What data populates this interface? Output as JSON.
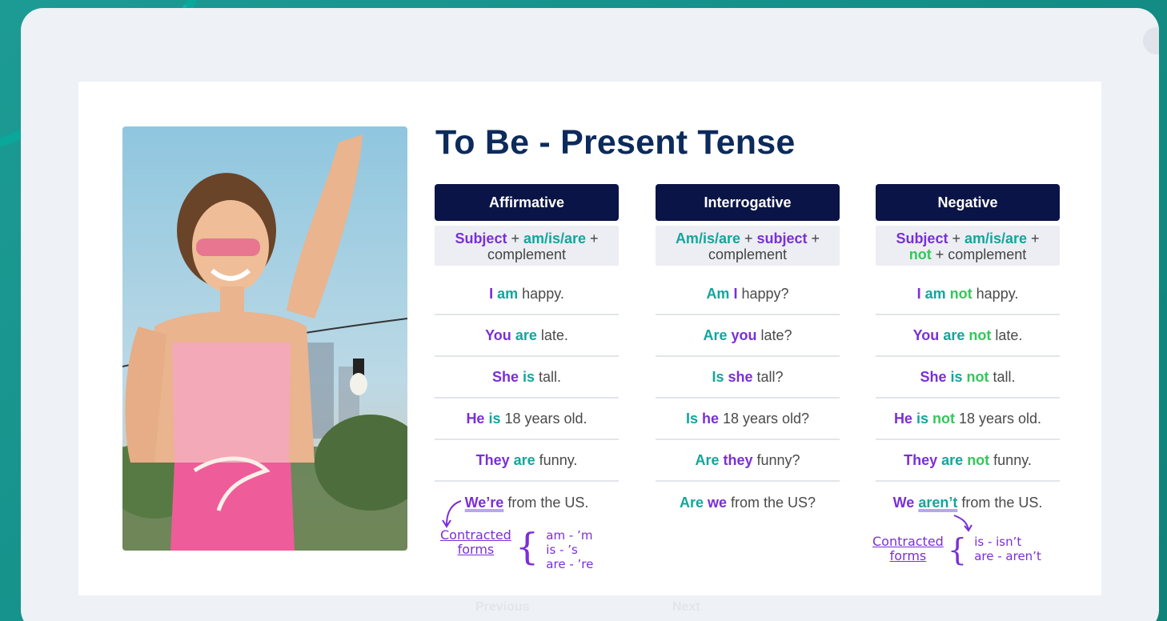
{
  "title": "To Be - Present Tense",
  "columns": [
    {
      "header": "Affirmative",
      "formula": [
        {
          "text": "Subject",
          "style": "p"
        },
        {
          "text": " + ",
          "style": ""
        },
        {
          "text": "am/is/are",
          "style": "t"
        },
        {
          "text": " + ",
          "style": ""
        },
        {
          "text": "complement",
          "style": "",
          "break": true
        }
      ],
      "rows": [
        [
          {
            "text": "I",
            "style": "p"
          },
          {
            "text": " ",
            "style": ""
          },
          {
            "text": "am",
            "style": "t"
          },
          {
            "text": " happy.",
            "style": ""
          }
        ],
        [
          {
            "text": "You",
            "style": "p"
          },
          {
            "text": " ",
            "style": ""
          },
          {
            "text": "are",
            "style": "t"
          },
          {
            "text": " late.",
            "style": ""
          }
        ],
        [
          {
            "text": "She",
            "style": "p"
          },
          {
            "text": " ",
            "style": ""
          },
          {
            "text": "is",
            "style": "t"
          },
          {
            "text": " tall.",
            "style": ""
          }
        ],
        [
          {
            "text": "He",
            "style": "p"
          },
          {
            "text": " ",
            "style": ""
          },
          {
            "text": "is",
            "style": "t"
          },
          {
            "text": " 18 years old.",
            "style": ""
          }
        ],
        [
          {
            "text": "They",
            "style": "p"
          },
          {
            "text": " ",
            "style": ""
          },
          {
            "text": "are",
            "style": "t"
          },
          {
            "text": " funny.",
            "style": ""
          }
        ],
        [
          {
            "text": "We’re",
            "style": "p u"
          },
          {
            "text": " from the US.",
            "style": ""
          }
        ]
      ]
    },
    {
      "header": "Interrogative",
      "formula": [
        {
          "text": "Am/is/are",
          "style": "t"
        },
        {
          "text": " + ",
          "style": ""
        },
        {
          "text": "subject",
          "style": "p"
        },
        {
          "text": " + ",
          "style": ""
        },
        {
          "text": "complement",
          "style": "",
          "break": true
        }
      ],
      "rows": [
        [
          {
            "text": "Am",
            "style": "t"
          },
          {
            "text": " ",
            "style": ""
          },
          {
            "text": "I",
            "style": "p"
          },
          {
            "text": " happy?",
            "style": ""
          }
        ],
        [
          {
            "text": "Are",
            "style": "t"
          },
          {
            "text": " ",
            "style": ""
          },
          {
            "text": "you",
            "style": "p"
          },
          {
            "text": " late?",
            "style": ""
          }
        ],
        [
          {
            "text": "Is",
            "style": "t"
          },
          {
            "text": " ",
            "style": ""
          },
          {
            "text": "she",
            "style": "p"
          },
          {
            "text": " tall?",
            "style": ""
          }
        ],
        [
          {
            "text": "Is",
            "style": "t"
          },
          {
            "text": " ",
            "style": ""
          },
          {
            "text": "he",
            "style": "p"
          },
          {
            "text": " 18 years old?",
            "style": ""
          }
        ],
        [
          {
            "text": "Are",
            "style": "t"
          },
          {
            "text": " ",
            "style": ""
          },
          {
            "text": "they",
            "style": "p"
          },
          {
            "text": " funny?",
            "style": ""
          }
        ],
        [
          {
            "text": "Are",
            "style": "t"
          },
          {
            "text": " ",
            "style": ""
          },
          {
            "text": "we",
            "style": "p"
          },
          {
            "text": " from the US?",
            "style": ""
          }
        ]
      ]
    },
    {
      "header": "Negative",
      "formula": [
        {
          "text": "Subject",
          "style": "p"
        },
        {
          "text": " + ",
          "style": ""
        },
        {
          "text": "am/is/are",
          "style": "t"
        },
        {
          "text": " + ",
          "style": ""
        },
        {
          "text": "not",
          "style": "g",
          "break": true
        },
        {
          "text": " + complement",
          "style": ""
        }
      ],
      "rows": [
        [
          {
            "text": "I",
            "style": "p"
          },
          {
            "text": " ",
            "style": ""
          },
          {
            "text": "am",
            "style": "t"
          },
          {
            "text": " ",
            "style": ""
          },
          {
            "text": "not",
            "style": "g"
          },
          {
            "text": " happy.",
            "style": ""
          }
        ],
        [
          {
            "text": "You",
            "style": "p"
          },
          {
            "text": " ",
            "style": ""
          },
          {
            "text": "are",
            "style": "t"
          },
          {
            "text": " ",
            "style": ""
          },
          {
            "text": "not",
            "style": "g"
          },
          {
            "text": " late.",
            "style": ""
          }
        ],
        [
          {
            "text": "She",
            "style": "p"
          },
          {
            "text": " ",
            "style": ""
          },
          {
            "text": "is",
            "style": "t"
          },
          {
            "text": " ",
            "style": ""
          },
          {
            "text": "not",
            "style": "g"
          },
          {
            "text": " tall.",
            "style": ""
          }
        ],
        [
          {
            "text": "He",
            "style": "p"
          },
          {
            "text": " ",
            "style": ""
          },
          {
            "text": "is",
            "style": "t"
          },
          {
            "text": " ",
            "style": ""
          },
          {
            "text": "not",
            "style": "g"
          },
          {
            "text": " 18 years old.",
            "style": ""
          }
        ],
        [
          {
            "text": "They",
            "style": "p"
          },
          {
            "text": " ",
            "style": ""
          },
          {
            "text": "are",
            "style": "t"
          },
          {
            "text": " ",
            "style": ""
          },
          {
            "text": "not",
            "style": "g"
          },
          {
            "text": " funny.",
            "style": ""
          }
        ],
        [
          {
            "text": "We",
            "style": "p"
          },
          {
            "text": " ",
            "style": ""
          },
          {
            "text": "aren’t",
            "style": "t u"
          },
          {
            "text": " from the US.",
            "style": ""
          }
        ]
      ]
    }
  ],
  "notes": {
    "contracted_label_1": "Contracted",
    "contracted_label_2": "forms",
    "affirmative_items": [
      "am - ’m",
      "is - ’s",
      "are - ’re"
    ],
    "negative_items": [
      "is - isn’t",
      "are - aren’t"
    ]
  },
  "nav": {
    "previous": "Previous",
    "next": "Next"
  },
  "colors": {
    "purple": "#7a2fd6",
    "teal": "#12a69c",
    "green": "#34c759",
    "header": "#0b1447",
    "title": "#0d2a5c"
  },
  "icons": {
    "corner": "circle-button-icon",
    "photo": "photo-woman-image"
  }
}
